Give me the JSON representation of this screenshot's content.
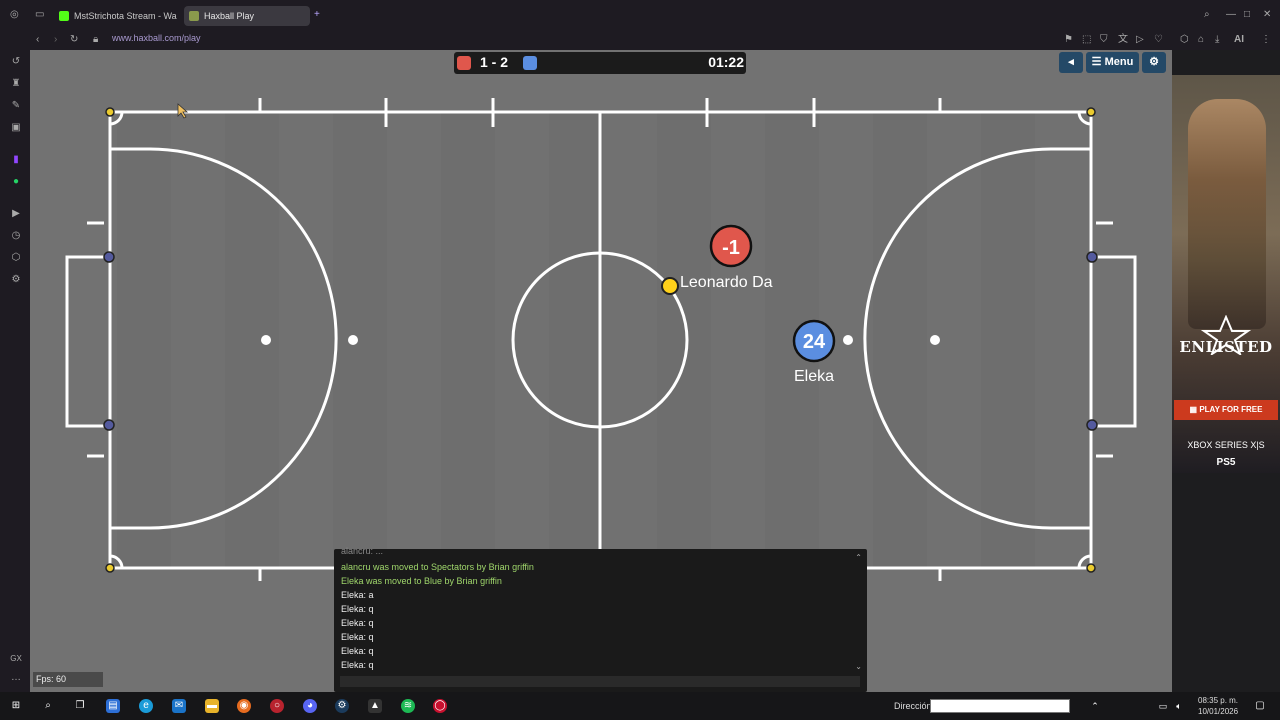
{
  "browser": {
    "tabs": [
      {
        "label": "MstStrichota Stream - Wa",
        "active": false
      },
      {
        "label": "Haxball Play",
        "active": true
      }
    ],
    "new_tab_label": "+",
    "url": "www.haxball.com/play",
    "toolbar_right_label": "AI"
  },
  "game": {
    "score": "1 - 2",
    "red_color": "#e0574c",
    "blue_color": "#5b8ee0",
    "timer": "01:22",
    "menu_label": "Menu",
    "players": [
      {
        "number": "-1",
        "team": "red",
        "name": ""
      },
      {
        "number": "24",
        "team": "blue",
        "name": "Eleka"
      }
    ],
    "floating_name": "Leonardo Da",
    "fps_label": "Fps: 60"
  },
  "chat": {
    "partial_top": "alancru: ...",
    "lines": [
      {
        "text": "alancru was moved to Spectators by Brian griffin",
        "type": "system"
      },
      {
        "text": "Eleka was moved to Blue by Brian griffin",
        "type": "system"
      },
      {
        "text": "Eleka: a",
        "type": "msg"
      },
      {
        "text": "Eleka: q",
        "type": "msg"
      },
      {
        "text": "Eleka: q",
        "type": "msg"
      },
      {
        "text": "Eleka: q",
        "type": "msg"
      },
      {
        "text": "Eleka: q",
        "type": "msg"
      },
      {
        "text": "Eleka: q",
        "type": "msg"
      }
    ]
  },
  "ad": {
    "brand": "ENLISTED",
    "cta": "PLAY FOR FREE",
    "platform1": "XBOX SERIES X|S",
    "platform2": "PS5"
  },
  "taskbar": {
    "direccion_label": "Dirección",
    "time": "08:35 p. m.",
    "date": "10/01/2026"
  },
  "sidebar_bottom_label": "GX"
}
